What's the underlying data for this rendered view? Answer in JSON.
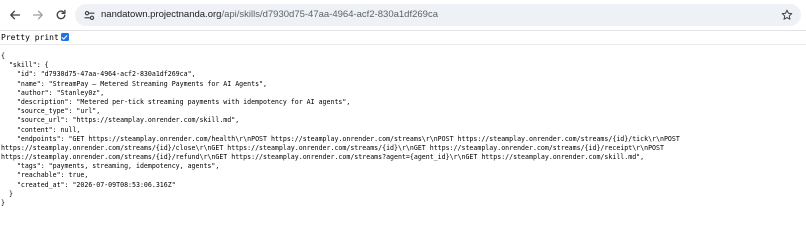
{
  "browser": {
    "url_host": "nandatown.projectnanda.org",
    "url_path": "/api/skills/d7930d75-47aa-4964-acf2-830a1df269ca",
    "icons": {
      "back": "arrow-left-icon",
      "forward": "arrow-right-icon",
      "reload": "reload-icon",
      "site_info": "site-info-tune-icon",
      "bookmark": "star-icon"
    }
  },
  "pretty_print": {
    "label": "Pretty print",
    "checked": true,
    "accent_color": "#1a73e8"
  },
  "json_lines": [
    "{",
    "  \"skill\": {",
    "    \"id\": \"d7930d75-47aa-4964-acf2-830a1df269ca\",",
    "    \"name\": \"StreamPay — Metered Streaming Payments for AI Agents\",",
    "    \"author\": \"Stanley0z\",",
    "    \"description\": \"Metered per-tick streaming payments with idempotency for AI agents\",",
    "    \"source_type\": \"url\",",
    "    \"source_url\": \"https://steamplay.onrender.com/skill.md\",",
    "    \"content\": null,",
    "    \"endpoints\": \"GET https://steamplay.onrender.com/health\\r\\nPOST https://steamplay.onrender.com/streams\\r\\nPOST https://steamplay.onrender.com/streams/{id}/tick\\r\\nPOST",
    "https://steamplay.onrender.com/streams/{id}/close\\r\\nGET https://steamplay.onrender.com/streams/{id}\\r\\nGET https://steamplay.onrender.com/streams/{id}/receipt\\r\\nPOST",
    "https://steamplay.onrender.com/streams/{id}/refund\\r\\nGET https://steamplay.onrender.com/streams?agent={agent_id}\\r\\nGET https://steamplay.onrender.com/skill.md\",",
    "    \"tags\": \"payments, streaming, idempotency, agents\",",
    "    \"reachable\": true,",
    "    \"created_at\": \"2026-07-09T08:53:06.316Z\"",
    "  }",
    "}"
  ]
}
